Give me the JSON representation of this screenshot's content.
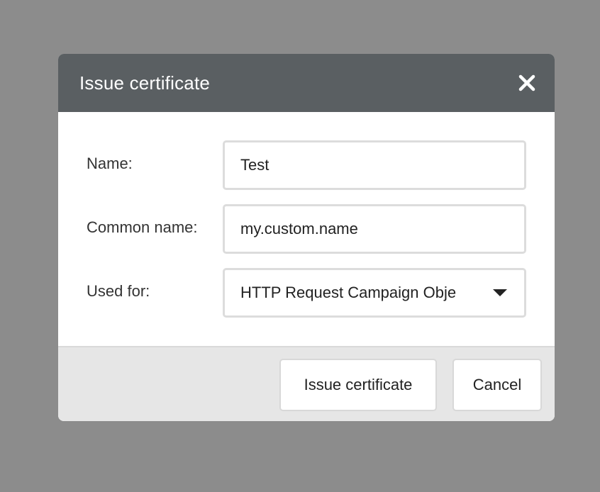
{
  "dialog": {
    "title": "Issue certificate",
    "close_icon": "close-icon"
  },
  "form": {
    "name": {
      "label": "Name:",
      "value": "Test"
    },
    "common_name": {
      "label": "Common name:",
      "value": "my.custom.name"
    },
    "used_for": {
      "label": "Used for:",
      "value": "HTTP Request Campaign Obje",
      "icon": "chevron-down-icon"
    }
  },
  "footer": {
    "issue_label": "Issue certificate",
    "cancel_label": "Cancel"
  },
  "colors": {
    "overlay": "#8c8c8c",
    "header": "#5a5f62",
    "footer": "#e6e6e6"
  }
}
